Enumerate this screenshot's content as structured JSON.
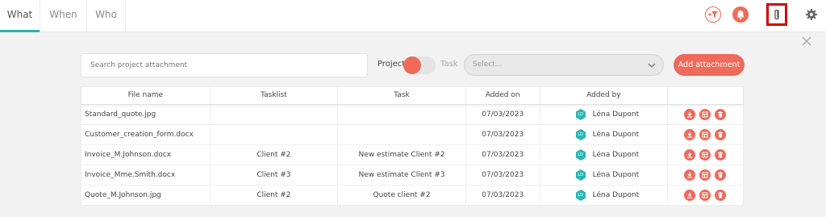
{
  "tabs": [
    {
      "label": "What",
      "active": true
    },
    {
      "label": "When",
      "active": false
    },
    {
      "label": "Who",
      "active": false
    }
  ],
  "header_icons": [
    "filter-plus-icon",
    "bell-icon",
    "paperclip-icon",
    "gear-icon"
  ],
  "accent_colors": {
    "primary": "#ef6a5a",
    "tab_underline": "#27b2b1",
    "highlight_box": "#d50000",
    "avatar": "#2bb5b5"
  },
  "toolbar": {
    "search_placeholder": "Search project attachment",
    "toggle_left_label": "Project",
    "toggle_right_label": "Task",
    "select_placeholder": "Select...",
    "add_button_label": "Add attachment"
  },
  "table": {
    "headers": [
      "File name",
      "Tasklist",
      "Task",
      "Added on",
      "Added by"
    ],
    "rows": [
      {
        "file": "Standard_quote.jpg",
        "tasklist": "",
        "task": "",
        "added_on": "07/03/2023",
        "initials": "LD",
        "added_by": "Léna Dupont"
      },
      {
        "file": "Customer_creation_form.docx",
        "tasklist": "",
        "task": "",
        "added_on": "07/03/2023",
        "initials": "LD",
        "added_by": "Léna Dupont"
      },
      {
        "file": "Invoice_M.Johnson.docx",
        "tasklist": "Client #2",
        "task": "New estimate Client #2",
        "added_on": "07/03/2023",
        "initials": "LD",
        "added_by": "Léna Dupont"
      },
      {
        "file": "Invoice_Mme.Smith.docx",
        "tasklist": "Client #3",
        "task": "New estimate Client #3",
        "added_on": "07/03/2023",
        "initials": "LD",
        "added_by": "Léna Dupont"
      },
      {
        "file": "Quote_M.Johnson.jpg",
        "tasklist": "Client #2",
        "task": "Quote client #2",
        "added_on": "07/03/2023",
        "initials": "LD",
        "added_by": "Léna Dupont"
      }
    ],
    "row_action_icons": [
      "download-icon",
      "view-icon",
      "trash-icon"
    ]
  }
}
